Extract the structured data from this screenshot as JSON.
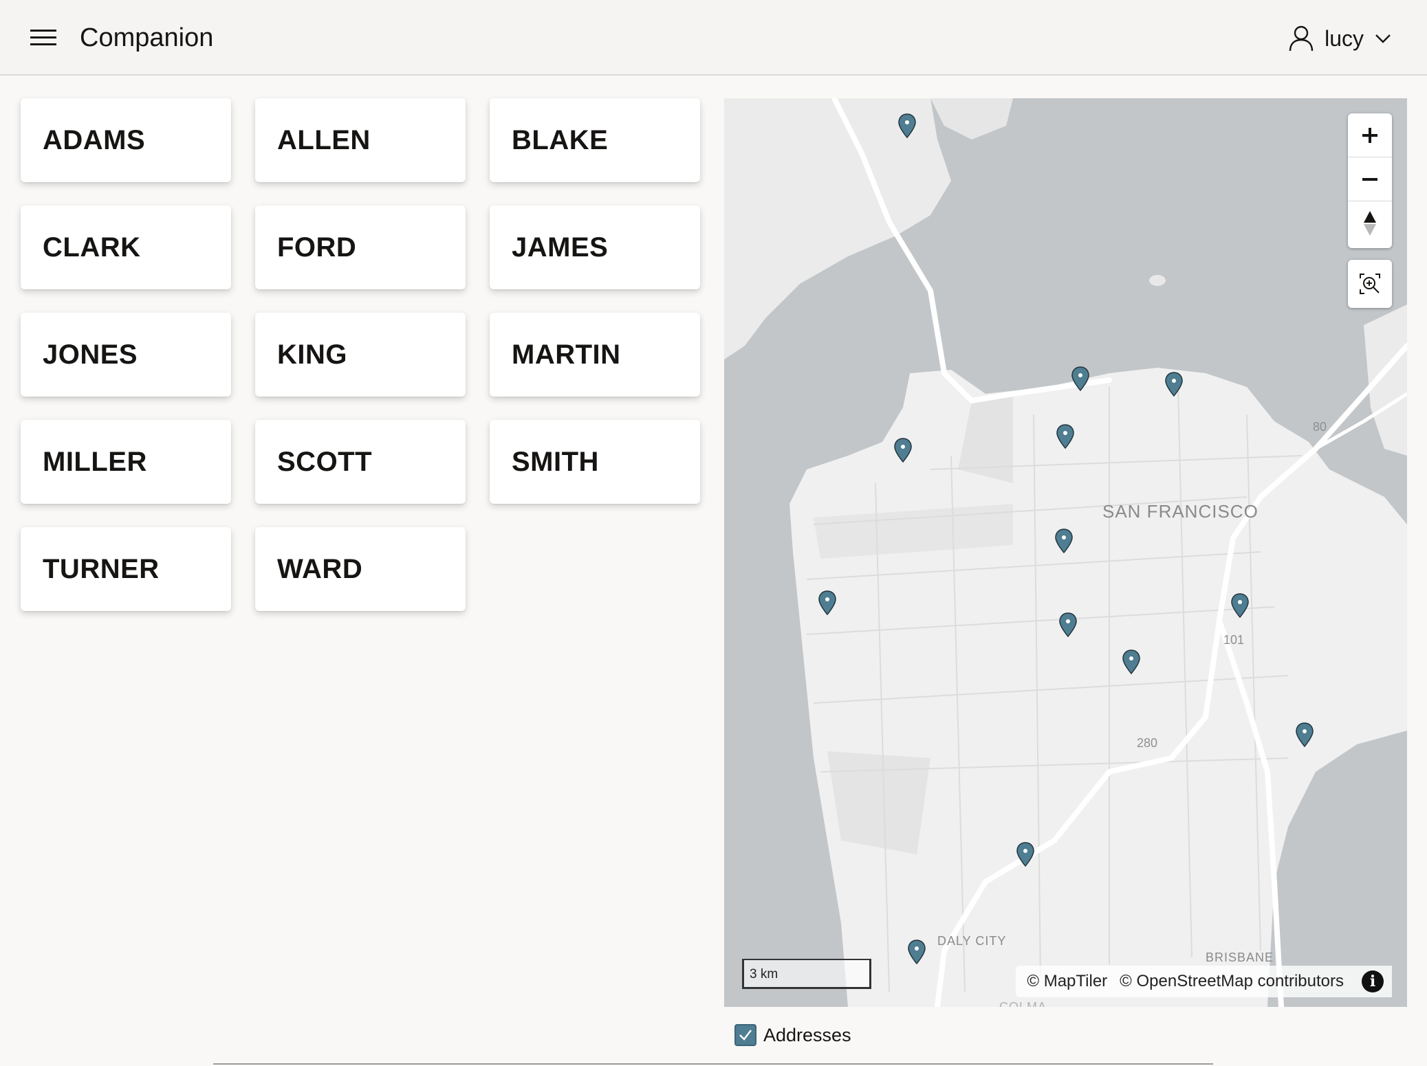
{
  "header": {
    "app_title": "Companion",
    "user_name": "lucy",
    "icons": {
      "menu": "hamburger-icon",
      "user": "user-icon",
      "dropdown": "chevron-down-icon"
    }
  },
  "employees": [
    "ADAMS",
    "ALLEN",
    "BLAKE",
    "CLARK",
    "FORD",
    "JAMES",
    "JONES",
    "KING",
    "MARTIN",
    "MILLER",
    "SCOTT",
    "SMITH",
    "TURNER",
    "WARD"
  ],
  "map": {
    "labels": {
      "city": "SAN FRANCISCO",
      "daly_city": "DALY CITY",
      "brisbane": "BRISBANE",
      "colma": "COLMA"
    },
    "highways": [
      "80",
      "101",
      "280"
    ],
    "scale": "3 km",
    "attribution": {
      "maptiler": "© MapTiler",
      "osm": "© OpenStreetMap contributors"
    },
    "pin_color": "#4f7d91",
    "controls": {
      "zoom_in": "plus-icon",
      "zoom_out": "minus-icon",
      "compass": "compass-icon",
      "zoom_extent": "zoom-extent-icon"
    }
  },
  "layer_toggle": {
    "label": "Addresses",
    "checked": true
  }
}
